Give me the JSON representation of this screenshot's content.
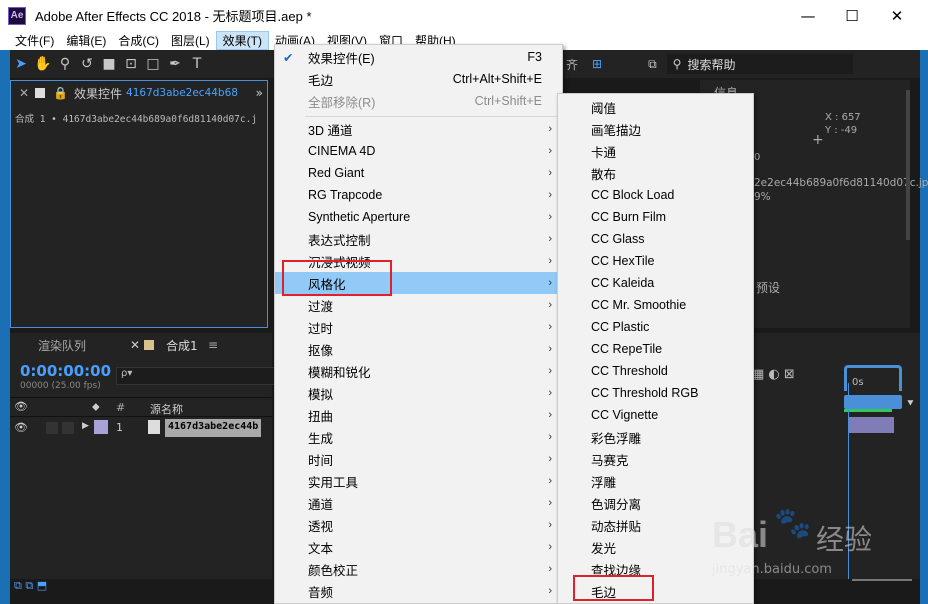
{
  "window": {
    "app_icon": "Ae",
    "title": "Adobe After Effects CC 2018 - 无标题项目.aep *",
    "controls": [
      "—",
      "☐",
      "✕"
    ]
  },
  "menubar": [
    "文件(F)",
    "编辑(E)",
    "合成(C)",
    "图层(L)",
    "效果(T)",
    "动画(A)",
    "视图(V)",
    "窗口",
    "帮助(H)"
  ],
  "effects_menu": {
    "items": [
      {
        "label": "效果控件(E)",
        "shortcut": "F3",
        "checked": true
      },
      {
        "label": "毛边",
        "shortcut": "Ctrl+Alt+Shift+E"
      },
      {
        "label": "全部移除(R)",
        "shortcut": "Ctrl+Shift+E",
        "disabled": true
      },
      {
        "label": "3D 通道",
        "submenu": true
      },
      {
        "label": "CINEMA 4D",
        "submenu": true
      },
      {
        "label": "Red Giant",
        "submenu": true
      },
      {
        "label": "RG Trapcode",
        "submenu": true
      },
      {
        "label": "Synthetic Aperture",
        "submenu": true
      },
      {
        "label": "表达式控制",
        "submenu": true
      },
      {
        "label": "沉浸式视频",
        "submenu": true
      },
      {
        "label": "风格化",
        "submenu": true,
        "highlighted": true
      },
      {
        "label": "过渡",
        "submenu": true
      },
      {
        "label": "过时",
        "submenu": true
      },
      {
        "label": "抠像",
        "submenu": true
      },
      {
        "label": "模糊和锐化",
        "submenu": true
      },
      {
        "label": "模拟",
        "submenu": true
      },
      {
        "label": "扭曲",
        "submenu": true
      },
      {
        "label": "生成",
        "submenu": true
      },
      {
        "label": "时间",
        "submenu": true
      },
      {
        "label": "实用工具",
        "submenu": true
      },
      {
        "label": "通道",
        "submenu": true
      },
      {
        "label": "透视",
        "submenu": true
      },
      {
        "label": "文本",
        "submenu": true
      },
      {
        "label": "颜色校正",
        "submenu": true
      },
      {
        "label": "音频",
        "submenu": true
      }
    ]
  },
  "stylize_submenu": {
    "items": [
      "阈值",
      "画笔描边",
      "卡通",
      "散布",
      "CC Block Load",
      "CC Burn Film",
      "CC Glass",
      "CC HexTile",
      "CC Kaleida",
      "CC Mr. Smoothie",
      "CC Plastic",
      "CC RepeTile",
      "CC Threshold",
      "CC Threshold RGB",
      "CC Vignette",
      "彩色浮雕",
      "马赛克",
      "浮雕",
      "色调分离",
      "动态拼贴",
      "发光",
      "查找边缘",
      "毛边"
    ]
  },
  "effects_panel": {
    "tab_label": "效果控件",
    "tab_file": "4167d3abe2ec44b68",
    "breadcrumb": "合成 1 • 4167d3abe2ec44b689a0f6d81140d07c.j"
  },
  "timeline": {
    "tab_render": "渲染队列",
    "tab_comp": "合成1",
    "timecode": "0:00:00:00",
    "frames": "00000 (25.00 fps)",
    "search_placeholder": "ρ▾",
    "col_num": "#",
    "col_name": "源名称",
    "layer_index": "1",
    "layer_name": "4167d3abe2ec44b",
    "ruler_label": "0s"
  },
  "info_panel": {
    "title": "信息",
    "x_label": "X : 657",
    "y_label": "Y : -49",
    "file": "2e2ec44b689a0f6d81140d07c.jpg",
    "percent": "9%",
    "zero": "0",
    "preset": "预设"
  },
  "search_help": "搜索帮助",
  "align_label": "齐",
  "watermark": {
    "brand": "Bai",
    "brand2": "经验",
    "url": "jingyan.baidu.com"
  }
}
